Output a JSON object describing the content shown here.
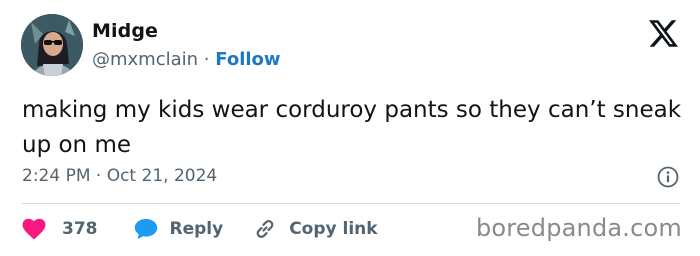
{
  "author": {
    "name": "Midge",
    "handle": "@mxmclain",
    "separator": "·",
    "follow_label": "Follow"
  },
  "tweet": {
    "text": "making my kids wear corduroy pants so they can’t sneak up on me",
    "timestamp": "2:24 PM · Oct 21, 2024"
  },
  "actions": {
    "likes_count": "378",
    "reply_label": "Reply",
    "copy_link_label": "Copy link"
  },
  "watermark": "boredpanda.com",
  "colors": {
    "heart": "#f91880",
    "reply_bubble": "#1d9bf0",
    "follow": "#1d78c8",
    "secondary_text": "#536471"
  },
  "icons": {
    "logo": "x-logo-icon",
    "like": "heart-icon",
    "reply": "speech-bubble-icon",
    "copy_link": "link-icon",
    "info": "info-icon"
  }
}
